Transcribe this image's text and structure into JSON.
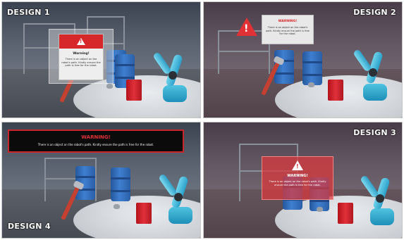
{
  "designs": [
    {
      "label": "DESIGN 1",
      "title": "Warning!",
      "message": "There is an object on the robot's path. Kindly ensure the path is free for the robot."
    },
    {
      "label": "DESIGN 2",
      "title": "WARNING!",
      "message": "There is an object on the robot's path. Kindly ensure the path is free for the robot."
    },
    {
      "label": "DESIGN 4",
      "title": "WARNING!",
      "message": "There is an object on the robot's path. Kindly ensure the path is free for the robot."
    },
    {
      "label": "DESIGN 3",
      "title": "WARNING!",
      "message": "There is an object on the robot's path. Kindly ensure the path is free for the robot."
    }
  ],
  "icons": {
    "warning": "warning-triangle-icon"
  },
  "colors": {
    "warning_red": "#d6282b",
    "banner_black": "#0b0b0b",
    "barrel_blue": "#3f7fd0",
    "robot_cyan": "#4fc3e0"
  }
}
